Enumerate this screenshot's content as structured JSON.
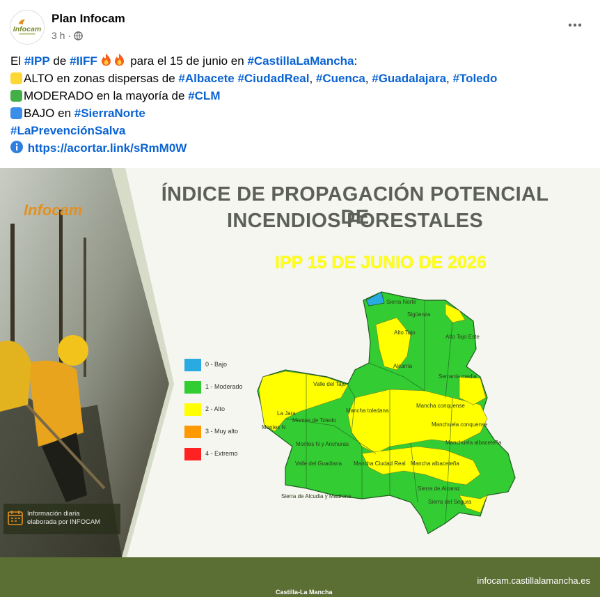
{
  "post": {
    "page_name": "Plan Infocam",
    "time": "3 h",
    "separator": "·",
    "avatar_text": "Infocam"
  },
  "text": {
    "l1_a": "El ",
    "l1_tag1": "#IPP",
    "l1_b": " de ",
    "l1_tag2": "#IIFF",
    "l1_c": " para el 15 de junio en ",
    "l1_tag3": "#CastillaLaMancha",
    "l1_d": ":",
    "l2_a": "ALTO en zonas dispersas de ",
    "l2_tag1": "#Albacete",
    "l2_tag2": "#CiudadReal",
    "l2_tag3": "#Cuenca",
    "l2_tag4": "#Guadalajara",
    "l2_tag5": "#Toledo",
    "l3_a": "MODERADO en la mayoría de ",
    "l3_tag1": "#CLM",
    "l4_a": "BAJO en ",
    "l4_tag1": "#SierraNorte",
    "l5_tag1": "#LaPrevenciónSalva",
    "l6_link": "https://acortar.link/sRmM0W",
    "comma": ","
  },
  "figure": {
    "title_line1": "ÍNDICE DE PROPAGACIÓN POTENCIAL DE",
    "title_line2": "INCENDIOS FORESTALES",
    "subtitle": "IPP 15 DE JUNIO DE 2026",
    "logo_text": "Infocam",
    "info_line1": "Información diaria",
    "info_line2": "elaborada por INFOCAM",
    "footer_url": "infocam.castillalamancha.es",
    "footer_brand": "Castilla-La Mancha",
    "legend": [
      {
        "label": "0 - Bajo",
        "color": "#29abe2"
      },
      {
        "label": "1 - Moderado",
        "color": "#33cc33"
      },
      {
        "label": "2 - Alto",
        "color": "#ffff00"
      },
      {
        "label": "3 - Muy alto",
        "color": "#ff9900"
      },
      {
        "label": "4 - Extremo",
        "color": "#ff2222"
      }
    ],
    "regions": {
      "r1": "Sierra Norte",
      "r2": "Sigüenza",
      "r3": "Alto Tajo",
      "r4": "Alto Tajo Este",
      "r5": "Alcarria",
      "r6": "Serranía media",
      "r7": "Valle del Tajo",
      "r8": "La Jara",
      "r9": "Montes de Toledo",
      "r10": "Mancha toledana",
      "r11": "Mancha conquense",
      "r12": "Manchuela conquense",
      "r13": "Manchuela albaceteña",
      "r14": "Montes N y Anchuras",
      "r15": "Valle del Guadiana",
      "r16": "Mancha Ciudad Real",
      "r17": "Mancha albaceteña",
      "r18": "Sierra de Alcaraz",
      "r19": "Sierra del Segura",
      "r20": "Sierra de Alcudia y Madrona",
      "r21": "Montes N"
    }
  }
}
